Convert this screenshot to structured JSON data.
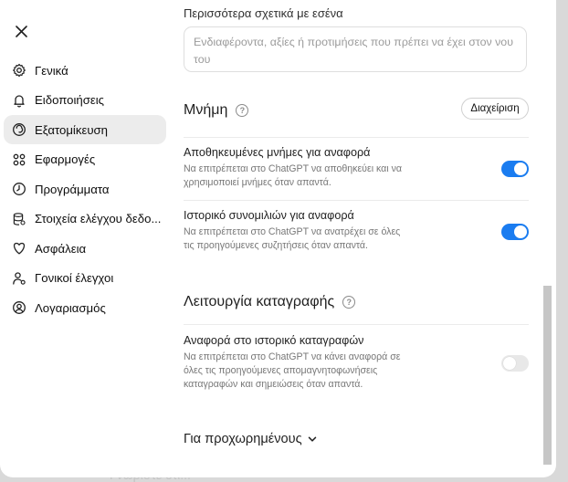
{
  "background": {
    "text": "Γνωρίστε ότι..."
  },
  "sidebar": {
    "items": [
      {
        "label": "Γενικά",
        "icon": "gear-icon",
        "active": false
      },
      {
        "label": "Ειδοποιήσεις",
        "icon": "bell-icon",
        "active": false
      },
      {
        "label": "Εξατομίκευση",
        "icon": "personalization-icon",
        "active": true
      },
      {
        "label": "Εφαρμογές",
        "icon": "apps-grid-icon",
        "active": false
      },
      {
        "label": "Προγράμματα",
        "icon": "clock-icon",
        "active": false
      },
      {
        "label": "Στοιχεία ελέγχου δεδο...",
        "icon": "database-icon",
        "active": false
      },
      {
        "label": "Ασφάλεια",
        "icon": "shield-icon",
        "active": false
      },
      {
        "label": "Γονικοί έλεγχοι",
        "icon": "parental-user-icon",
        "active": false
      },
      {
        "label": "Λογαριασμός",
        "icon": "account-icon",
        "active": false
      }
    ]
  },
  "more_about_you": {
    "label": "Περισσότερα σχετικά με εσένα",
    "placeholder": "Ενδιαφέροντα, αξίες ή προτιμήσεις που πρέπει να έχει στον νου του"
  },
  "memory": {
    "title": "Μνήμη",
    "manage_label": "Διαχείριση",
    "rows": [
      {
        "title": "Αποθηκευμένες μνήμες για αναφορά",
        "description": "Να επιτρέπεται στο ChatGPT να αποθηκεύει και να χρησιμοποιεί μνήμες όταν απαντά.",
        "enabled": true
      },
      {
        "title": "Ιστορικό συνομιλιών για αναφορά",
        "description": "Να επιτρέπεται στο ChatGPT να ανατρέχει σε όλες τις προηγούμενες συζητήσεις όταν απαντά.",
        "enabled": true
      }
    ]
  },
  "recording": {
    "title": "Λειτουργία καταγραφής",
    "rows": [
      {
        "title": "Αναφορά στο ιστορικό καταγραφών",
        "description": "Να επιτρέπεται στο ChatGPT να κάνει αναφορά σε όλες τις προηγούμενες απομαγνητοφωνήσεις καταγραφών και σημειώσεις όταν απαντά.",
        "enabled": false
      }
    ]
  },
  "advanced": {
    "label": "Για προχωρημένους"
  },
  "colors": {
    "accent": "#1a7cf0",
    "active_nav": "#ececec"
  }
}
